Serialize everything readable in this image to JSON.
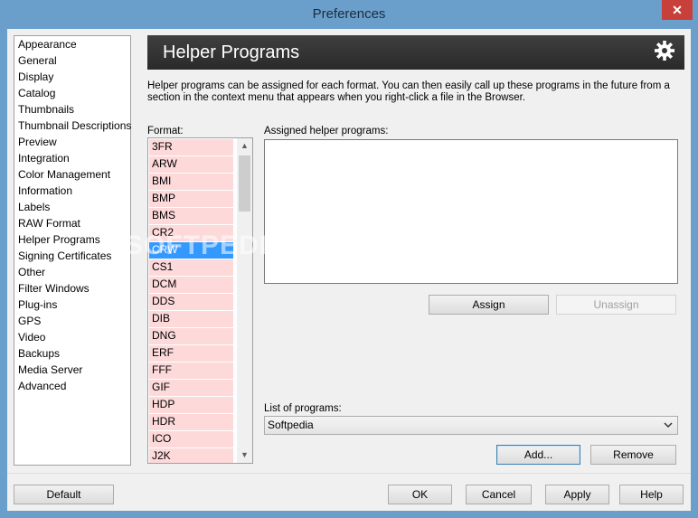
{
  "window": {
    "title": "Preferences",
    "close_glyph": "✕"
  },
  "nav": {
    "items": [
      "Appearance",
      "General",
      "Display",
      "Catalog",
      "Thumbnails",
      "Thumbnail Descriptions",
      "Preview",
      "Integration",
      "Color Management",
      "Information",
      "Labels",
      "RAW Format",
      "Helper Programs",
      "Signing Certificates",
      "Other",
      "Filter Windows",
      "Plug-ins",
      "GPS",
      "Video",
      "Backups",
      "Media Server",
      "Advanced"
    ],
    "selected": "Helper Programs"
  },
  "header": {
    "title": "Helper Programs",
    "icon": "gear-icon"
  },
  "description": "Helper programs can be assigned for each format. You can then easily call up these programs in the future from a section in the  context menu that appears when you right-click a file in the Browser.",
  "format": {
    "label": "Format:",
    "items": [
      "3FR",
      "ARW",
      "BMI",
      "BMP",
      "BMS",
      "CR2",
      "CRW",
      "CS1",
      "DCM",
      "DDS",
      "DIB",
      "DNG",
      "ERF",
      "FFF",
      "GIF",
      "HDP",
      "HDR",
      "ICO",
      "J2K"
    ],
    "selected": "CRW",
    "scroll_up": "▲",
    "scroll_down": "▼"
  },
  "assigned": {
    "label": "Assigned helper programs:",
    "assign_label": "Assign",
    "unassign_label": "Unassign"
  },
  "programs": {
    "label": "List of programs:",
    "selected": "Softpedia",
    "add_label": "Add...",
    "remove_label": "Remove"
  },
  "footer": {
    "default_label": "Default",
    "ok_label": "OK",
    "cancel_label": "Cancel",
    "apply_label": "Apply",
    "help_label": "Help"
  },
  "watermark": "SOFTPEDIA",
  "colors": {
    "accent": "#3399ff",
    "format_bg": "#fdd9da",
    "header_bg": "#333333",
    "frame": "#6b9fcb"
  }
}
